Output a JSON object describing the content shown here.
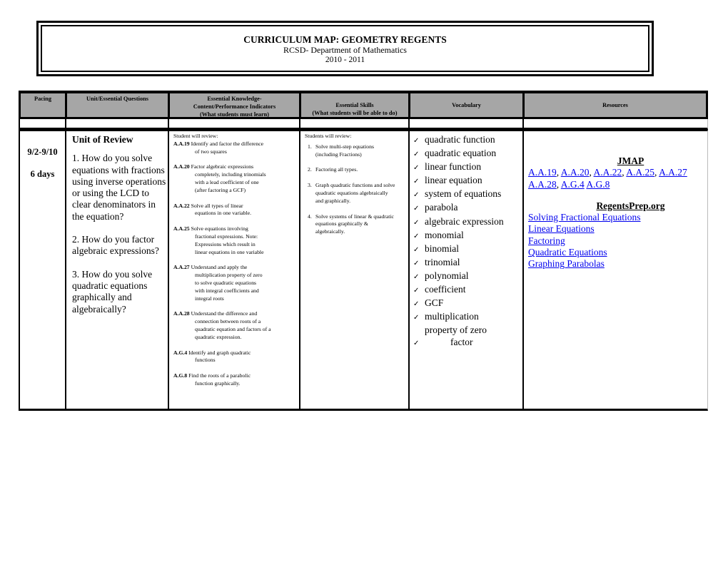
{
  "header": {
    "title": "CURRICULUM MAP: GEOMETRY REGENTS",
    "subtitle": "RCSD- Department of Mathematics",
    "year": "2010 - 2011"
  },
  "columns": [
    {
      "label": "Pacing"
    },
    {
      "label": "Unit/Essential Questions"
    },
    {
      "label_lines": [
        "Essential Knowledge-",
        "Content/Performance Indicators",
        "(What students must learn)"
      ]
    },
    {
      "label_lines": [
        "Essential Skills",
        "(What students will be able to do)"
      ]
    },
    {
      "label": "Vocabulary"
    },
    {
      "label": "Resources"
    }
  ],
  "row": {
    "pacing": {
      "dates": "9/2-9/10",
      "days": "6 days"
    },
    "unit": {
      "title": "Unit of Review",
      "questions": [
        "1.  How do you solve equations with fractions using inverse operations or using the LCD to clear denominators in the equation?",
        "2.  How do you factor algebraic expressions?",
        "3.  How do you solve quadratic equations graphically and algebraically?"
      ]
    },
    "knowledge": {
      "intro": "Student will review:",
      "items": [
        {
          "code": "A.A.19",
          "lines": [
            "Identify and factor the difference",
            "of two squares"
          ]
        },
        {
          "code": "A.A.20",
          "lines": [
            "Factor algebraic expressions",
            "completely, including trinomials",
            "with a lead  coefficient of one",
            "(after factoring a  GCF)"
          ]
        },
        {
          "code": "A.A.22",
          "lines": [
            "Solve all  types of linear",
            "equations in one variable."
          ]
        },
        {
          "code": "A.A.25",
          "lines": [
            "Solve equations involving",
            "fractional  expressions. Note:",
            "Expressions which  result in",
            "linear equations in one variable"
          ]
        },
        {
          "code": "A.A.27",
          "lines": [
            "Understand and apply the",
            "multiplication  property of zero",
            "to solve quadratic  equations",
            "with integral coefficients and",
            "integral roots"
          ]
        },
        {
          "code": "A.A.28",
          "lines": [
            "Understand the difference and",
            "connection between roots of a",
            "quadratic equation and factors of a",
            "quadratic expression."
          ]
        },
        {
          "code": "A.G.4",
          "lines": [
            "Identify and graph quadratic",
            "functions"
          ]
        },
        {
          "code": "A.G.8",
          "lines": [
            "Find the roots of a parabolic",
            "function graphically."
          ]
        }
      ]
    },
    "skills": {
      "intro": "Students will review:",
      "items": [
        {
          "num": "1.",
          "text": "Solve multi-step equations (including Fractions)"
        },
        {
          "num": "2.",
          "text": " Factoring all types."
        },
        {
          "num": "3.",
          "text": "Graph quadratic functions and solve quadratic equations algebraically and graphically."
        },
        {
          "num": "4.",
          "text": "Solve systems of linear & quadratic equations graphically & algebraically."
        }
      ]
    },
    "vocabulary": {
      "check_glyph": "✓",
      "items": [
        "quadratic function",
        "quadratic equation",
        "linear function",
        "linear equation",
        "system of equations",
        "parabola",
        "algebraic expression",
        "monomial",
        "binomial",
        "trinomial",
        "polynomial",
        "coefficient",
        "GCF",
        "multiplication"
      ],
      "continuation": "property of zero",
      "last_item": "factor"
    },
    "resources": {
      "jmap": {
        "heading": "JMAP",
        "links": [
          "A.A.19",
          "A.A.20",
          "A.A.22",
          "A.A.25",
          "A.A.27",
          "A.A.28",
          "A.G.4",
          "A.G.8"
        ]
      },
      "regentsprep": {
        "heading": "RegentsPrep.org",
        "links": [
          "Solving Fractional Equations",
          "Linear Equations",
          "Factoring",
          "Quadratic Equations",
          "Graphing Parabolas"
        ]
      },
      "link_color": "#0000ee"
    }
  },
  "colors": {
    "header_bg": "#a6a6a6",
    "border": "#000000"
  }
}
